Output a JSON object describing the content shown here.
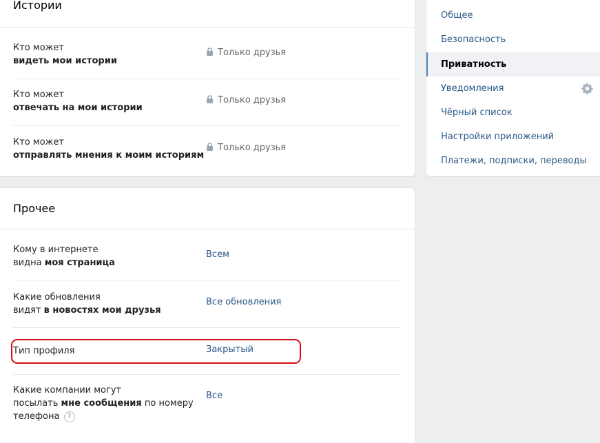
{
  "stories": {
    "title": "Истории",
    "rows": [
      {
        "label_plain": "Кто может",
        "label_bold": "видеть мои истории",
        "value": "Только друзья"
      },
      {
        "label_plain": "Кто может",
        "label_bold": "отвечать на мои истории",
        "value": "Только друзья"
      },
      {
        "label_plain": "Кто может",
        "label_bold": "отправлять мнения к моим историям",
        "value": "Только друзья"
      }
    ]
  },
  "other": {
    "title": "Прочее",
    "row1": {
      "line1": "Кому в интернете",
      "line2_plain": "видна ",
      "line2_bold": "моя страница",
      "value": "Всем"
    },
    "row2": {
      "line1": "Какие обновления",
      "line2_plain": "видят ",
      "line2_bold": "в новостях мои друзья",
      "value": "Все обновления"
    },
    "row3": {
      "label": "Тип профиля",
      "value": "Закрытый"
    },
    "row4": {
      "line1": "Какие компании могут",
      "line2_plain": "посылать ",
      "line2_bold": "мне сообщения",
      "line2_tail": " по номеру",
      "line3": "телефона",
      "help": "?",
      "value": "Все"
    }
  },
  "sidebar": {
    "items": [
      {
        "label": "Общее"
      },
      {
        "label": "Безопасность"
      },
      {
        "label": "Приватность"
      },
      {
        "label": "Уведомления"
      },
      {
        "label": "Чёрный список"
      },
      {
        "label": "Настройки приложений"
      },
      {
        "label": "Платежи, подписки, переводы"
      }
    ],
    "active_item": "Приватность"
  },
  "colors": {
    "link": "#2a5885",
    "highlight_border": "#d40d12",
    "active_marker": "#5181b8",
    "background": "#edeef0"
  },
  "icons": {
    "lock": "lock-icon",
    "gear": "gear-icon",
    "help": "question-icon"
  }
}
